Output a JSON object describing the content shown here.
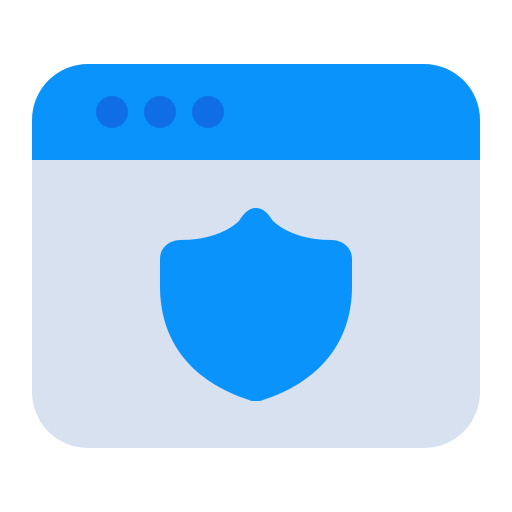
{
  "window": {
    "title": "",
    "controls": [
      "dot-1",
      "dot-2",
      "dot-3"
    ],
    "colors": {
      "titlebar": "#0a93fb",
      "body": "#d7e1ef",
      "dots": "#0f6ee6",
      "shield": "#0a93fb"
    }
  },
  "content": {
    "icon": "shield-icon"
  }
}
